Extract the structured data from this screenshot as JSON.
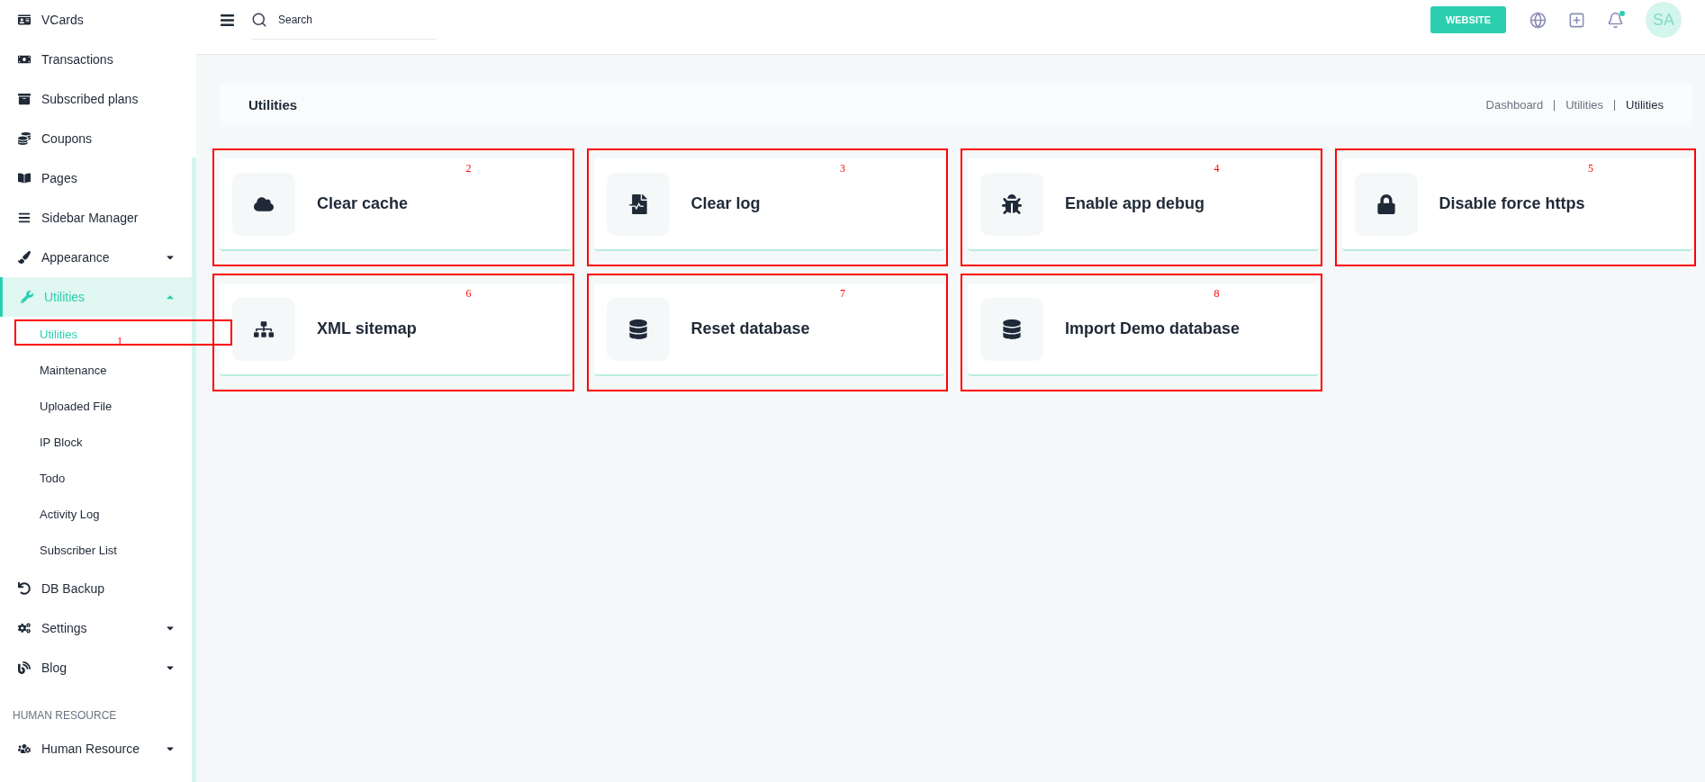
{
  "sidebar": {
    "items": [
      {
        "kind": "link",
        "label": "VCards",
        "selected": false
      },
      {
        "kind": "link",
        "label": "Transactions",
        "selected": false
      },
      {
        "kind": "link",
        "label": "Subscribed plans",
        "selected": false
      },
      {
        "kind": "link",
        "label": "Coupons",
        "selected": false
      },
      {
        "kind": "link",
        "label": "Pages",
        "selected": false
      },
      {
        "kind": "link",
        "label": "Sidebar Manager",
        "selected": false
      },
      {
        "kind": "group",
        "label": "Appearance",
        "selected": false,
        "expanded": false
      },
      {
        "kind": "group",
        "label": "Utilities",
        "selected": true,
        "expanded": true,
        "children": [
          {
            "label": "Utilities",
            "selected": true,
            "annotation": "1"
          },
          {
            "label": "Maintenance",
            "selected": false
          },
          {
            "label": "Uploaded File",
            "selected": false
          },
          {
            "label": "IP Block",
            "selected": false
          },
          {
            "label": "Todo",
            "selected": false
          },
          {
            "label": "Activity Log",
            "selected": false
          },
          {
            "label": "Subscriber List",
            "selected": false
          }
        ]
      },
      {
        "kind": "link",
        "label": "DB Backup",
        "selected": false
      },
      {
        "kind": "group",
        "label": "Settings",
        "selected": false,
        "expanded": false
      },
      {
        "kind": "group",
        "label": "Blog",
        "selected": false,
        "expanded": false
      },
      {
        "kind": "heading",
        "label": "HUMAN RESOURCE"
      },
      {
        "kind": "group",
        "label": "Human Resource",
        "selected": false,
        "expanded": false
      }
    ]
  },
  "header": {
    "search": {
      "placeholder": "Search"
    },
    "website_button": "WEBSITE",
    "notifications": {
      "unread": true
    },
    "avatar": "SA"
  },
  "page_header": {
    "title": "Utilities",
    "breadcrumbs": [
      {
        "label": "Dashboard",
        "selected": false
      },
      {
        "label": "Utilities",
        "selected": false
      },
      {
        "label": "Utilities",
        "selected": true
      }
    ]
  },
  "cards": [
    {
      "label": "Clear cache",
      "annotation": "2"
    },
    {
      "label": "Clear log",
      "annotation": "3"
    },
    {
      "label": "Enable app debug",
      "annotation": "4"
    },
    {
      "label": "Disable force https",
      "annotation": "5"
    },
    {
      "label": "XML sitemap",
      "annotation": "6"
    },
    {
      "label": "Reset database",
      "annotation": "7"
    },
    {
      "label": "Import Demo database",
      "annotation": "8"
    }
  ]
}
